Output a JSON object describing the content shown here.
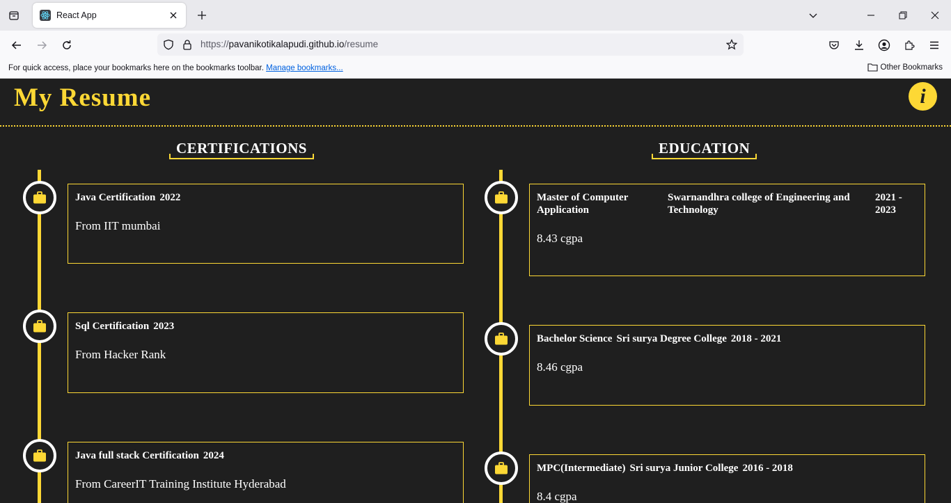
{
  "browser": {
    "tab_title": "React App",
    "url_scheme": "https://",
    "url_host": "pavanikotikalapudi.github.io",
    "url_path": "/resume",
    "bookmarks_prompt": "For quick access, place your bookmarks here on the bookmarks toolbar.",
    "manage_bookmarks": "Manage bookmarks...",
    "other_bookmarks": "Other Bookmarks"
  },
  "page": {
    "title": "My Resume",
    "info_glyph": "i",
    "accent_color": "#fdd835",
    "background_color": "#1f1f1f"
  },
  "certifications": {
    "heading": "CERTIFICATIONS",
    "items": [
      {
        "name": "Java Certification",
        "year": "2022",
        "source": "From IIT mumbai"
      },
      {
        "name": "Sql Certification",
        "year": "2023",
        "source": "From Hacker Rank"
      },
      {
        "name": "Java full stack Certification",
        "year": "2024",
        "source": "From CareerIT Training Institute Hyderabad"
      }
    ]
  },
  "education": {
    "heading": "EDUCATION",
    "items": [
      {
        "degree": "Master of Computer Application",
        "college": "Swarnandhra college of Engineering and Technology",
        "years": "2021 - 2023",
        "score": "8.43 cgpa"
      },
      {
        "degree": "Bachelor Science",
        "college": "Sri surya Degree College",
        "years": "2018 - 2021",
        "score": "8.46 cgpa"
      },
      {
        "degree": "MPC(Intermediate)",
        "college": "Sri surya Junior College",
        "years": "2016 - 2018",
        "score": "8.4 cgpa"
      }
    ]
  },
  "icons": {
    "timeline_node": "briefcase-icon",
    "info": "info-icon"
  }
}
